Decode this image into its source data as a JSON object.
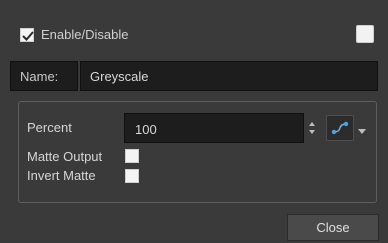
{
  "enable": {
    "label": "Enable/Disable",
    "checked": true,
    "color_swatch": "#f2f2f2"
  },
  "name": {
    "label": "Name:",
    "value": "Greyscale"
  },
  "percent": {
    "label": "Percent",
    "value": "100"
  },
  "matte_output": {
    "label": "Matte Output",
    "checked": false
  },
  "invert_matte": {
    "label": "Invert Matte",
    "checked": false
  },
  "close": {
    "label": "Close"
  }
}
